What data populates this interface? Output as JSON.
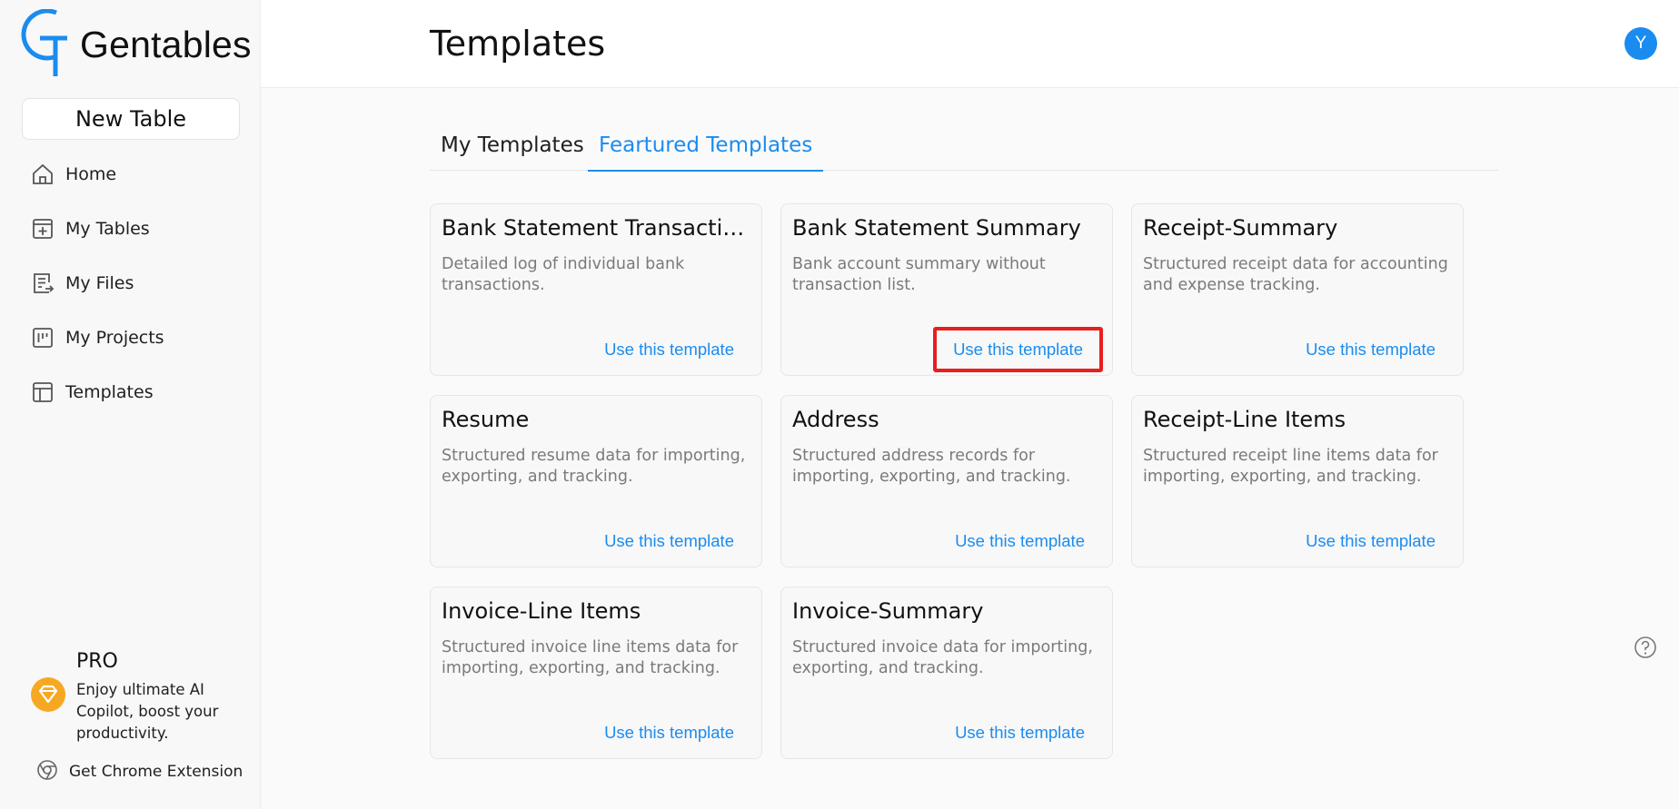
{
  "app": {
    "name": "Gentables"
  },
  "sidebar": {
    "new_table_label": "New Table",
    "items": [
      {
        "label": "Home",
        "icon": "home-icon"
      },
      {
        "label": "My Tables",
        "icon": "table-add-icon"
      },
      {
        "label": "My Files",
        "icon": "file-icon"
      },
      {
        "label": "My Projects",
        "icon": "project-icon"
      },
      {
        "label": "Templates",
        "icon": "template-icon"
      }
    ],
    "pro": {
      "title": "PRO",
      "description": "Enjoy ultimate AI Copilot, boost your productivity.",
      "icon": "diamond-icon"
    },
    "chrome_extension_label": "Get Chrome Extension"
  },
  "header": {
    "title": "Templates",
    "avatar_letter": "Y"
  },
  "tabs": [
    {
      "label": "My Templates",
      "active": false
    },
    {
      "label": "Feartured Templates",
      "active": true
    }
  ],
  "cards": [
    {
      "title": "Bank Statement Transactions",
      "description": "Detailed log of individual bank transactions.",
      "action": "Use this template"
    },
    {
      "title": "Bank Statement Summary",
      "description": "Bank account summary without transaction list.",
      "action": "Use this template",
      "highlighted": true
    },
    {
      "title": "Receipt-Summary",
      "description": "Structured receipt data for accounting and expense tracking.",
      "action": "Use this template"
    },
    {
      "title": "Resume",
      "description": "Structured resume data for importing, exporting, and tracking.",
      "action": "Use this template"
    },
    {
      "title": "Address",
      "description": "Structured address records for importing, exporting, and tracking.",
      "action": "Use this template"
    },
    {
      "title": "Receipt-Line Items",
      "description": "Structured receipt line items data for importing, exporting, and tracking.",
      "action": "Use this template"
    },
    {
      "title": "Invoice-Line Items",
      "description": "Structured invoice line items data for importing, exporting, and tracking.",
      "action": "Use this template"
    },
    {
      "title": "Invoice-Summary",
      "description": "Structured invoice data for importing, exporting, and tracking.",
      "action": "Use this template"
    }
  ],
  "colors": {
    "accent": "#1a8cf0",
    "highlight_box": "#e81e1e",
    "pro_badge": "#f7a823"
  }
}
